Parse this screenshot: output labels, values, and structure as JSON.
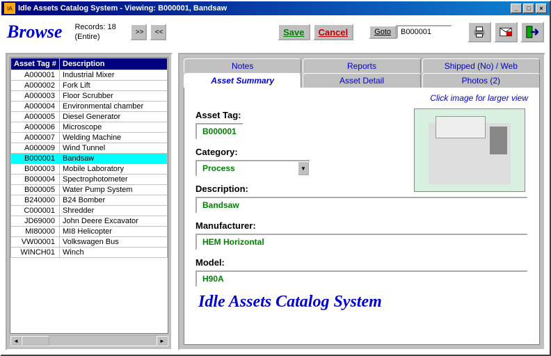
{
  "titlebar": {
    "text": "Idle Assets Catalog System - Viewing: B000001, Bandsaw"
  },
  "toolbar": {
    "browse_label": "Browse",
    "records_label": "Records: 18",
    "records_scope": "(Entire)",
    "save_label": "Save",
    "cancel_label": "Cancel",
    "goto_label": "Goto",
    "goto_value": "B000001"
  },
  "grid": {
    "col_tag": "Asset Tag #",
    "col_desc": "Description",
    "rows": [
      {
        "tag": "A000001",
        "desc": "Industrial Mixer"
      },
      {
        "tag": "A000002",
        "desc": "Fork Lift"
      },
      {
        "tag": "A000003",
        "desc": "Floor Scrubber"
      },
      {
        "tag": "A000004",
        "desc": "Environmental chamber"
      },
      {
        "tag": "A000005",
        "desc": "Diesel Generator"
      },
      {
        "tag": "A000006",
        "desc": "Microscope"
      },
      {
        "tag": "A000007",
        "desc": "Welding Machine"
      },
      {
        "tag": "A000009",
        "desc": "Wind Tunnel"
      },
      {
        "tag": "B000001",
        "desc": "Bandsaw"
      },
      {
        "tag": "B000003",
        "desc": "Mobile Laboratory"
      },
      {
        "tag": "B000004",
        "desc": "Spectrophotometer"
      },
      {
        "tag": "B000005",
        "desc": "Water Pump System"
      },
      {
        "tag": "B240000",
        "desc": "B24 Bomber"
      },
      {
        "tag": "C000001",
        "desc": "Shredder"
      },
      {
        "tag": "JD69000",
        "desc": "John Deere Excavator"
      },
      {
        "tag": "MI80000",
        "desc": "MI8 Helicopter"
      },
      {
        "tag": "VW00001",
        "desc": "Volkswagen Bus"
      },
      {
        "tag": "WINCH01",
        "desc": "Winch"
      }
    ],
    "selected_index": 8
  },
  "tabs": {
    "row1": [
      "Notes",
      "Reports",
      "Shipped (No) / Web"
    ],
    "row2": [
      "Asset Summary",
      "Asset Detail",
      "Photos (2)"
    ],
    "active": "Asset Summary"
  },
  "summary": {
    "hint": "Click image for larger view",
    "label_tag": "Asset Tag:",
    "val_tag": "B000001",
    "label_cat": "Category:",
    "val_cat": "Process",
    "label_desc": "Description:",
    "val_desc": "Bandsaw",
    "label_mfr": "Manufacturer:",
    "val_mfr": "HEM Horizontal",
    "label_model": "Model:",
    "val_model": "H90A"
  },
  "footer": {
    "title": "Idle Assets Catalog System"
  }
}
